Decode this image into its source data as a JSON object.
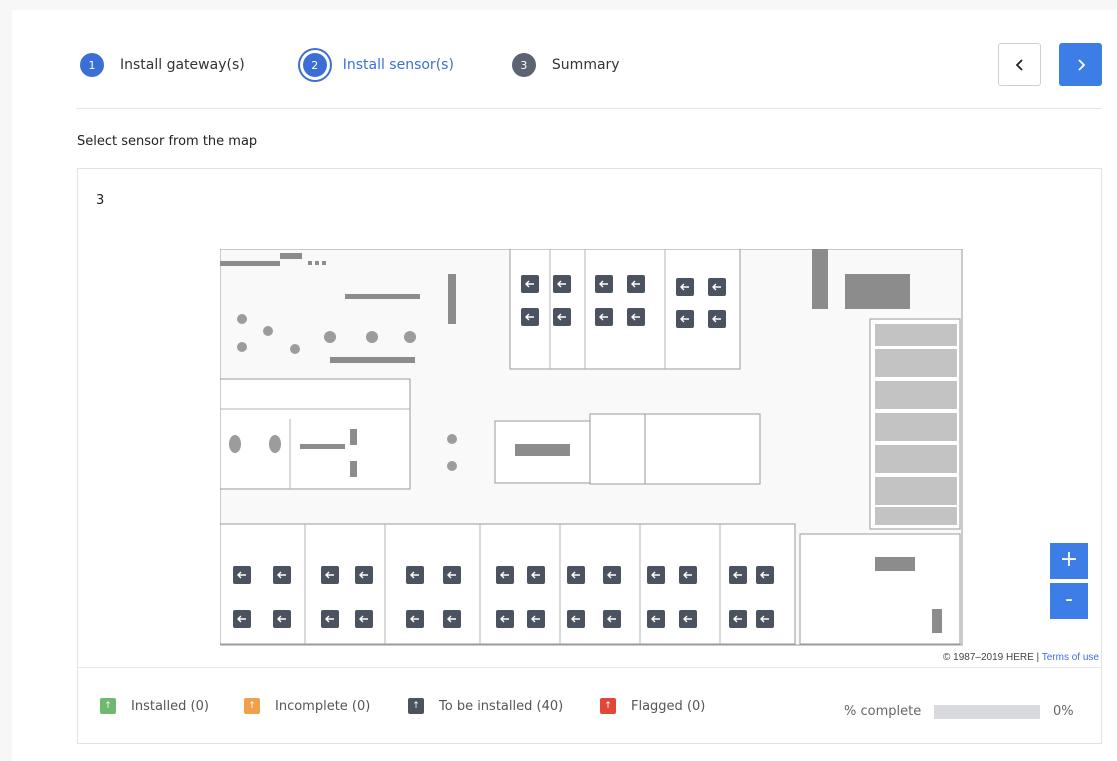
{
  "stepper": {
    "steps": [
      {
        "num": "1",
        "label": "Install gateway(s)"
      },
      {
        "num": "2",
        "label": "Install sensor(s)"
      },
      {
        "num": "3",
        "label": "Summary"
      }
    ]
  },
  "nav": {
    "prev_icon": "chevron-left-icon",
    "next_icon": "chevron-right-icon"
  },
  "section_title": "Select sensor from the map",
  "map": {
    "header_value": "3",
    "zoom_in": "+",
    "zoom_out": "-",
    "attribution": "© 1987–2019 HERE |",
    "terms": "Terms of use",
    "sensor_icon": "arrow-left-icon"
  },
  "legend": {
    "items": [
      {
        "label": "Installed (0)",
        "color": "#6fb96f"
      },
      {
        "label": "Incomplete (0)",
        "color": "#f0a04b"
      },
      {
        "label": "To be installed (40)",
        "color": "#4b5360"
      },
      {
        "label": "Flagged (0)",
        "color": "#e0473a"
      }
    ],
    "percent_label": "% complete",
    "percent_value": "0%",
    "percent_fraction": 0
  },
  "colors": {
    "accent": "#3d7ee6",
    "sensor": "#4b5360"
  }
}
